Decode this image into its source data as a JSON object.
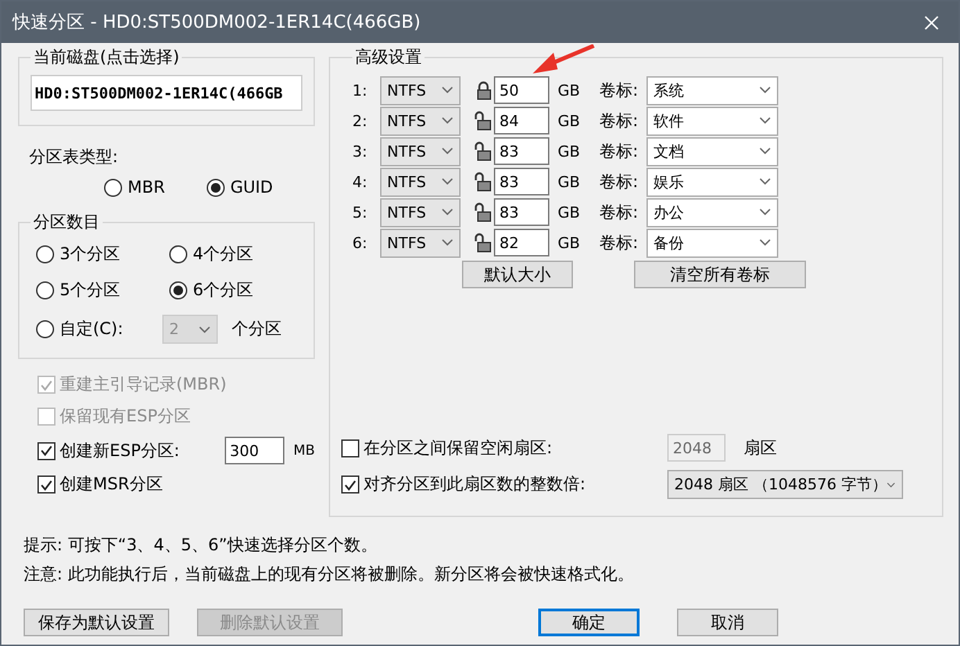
{
  "window": {
    "title": "快速分区 - HD0:ST500DM002-1ER14C(466GB)"
  },
  "disk": {
    "label": "当前磁盘(点击选择)",
    "value": "HD0:ST500DM002-1ER14C(466GB"
  },
  "table_type": {
    "label": "分区表类型:",
    "options": [
      {
        "label": "MBR",
        "selected": false
      },
      {
        "label": "GUID",
        "selected": true
      }
    ]
  },
  "count": {
    "label": "分区数目",
    "options": [
      {
        "kind": "preset",
        "label": "3个分区",
        "selected": false
      },
      {
        "kind": "preset",
        "label": "4个分区",
        "selected": false
      },
      {
        "kind": "preset",
        "label": "5个分区",
        "selected": false
      },
      {
        "kind": "preset",
        "label": "6个分区",
        "selected": true
      },
      {
        "kind": "custom",
        "label": "自定(C):",
        "selected": false,
        "value": "2",
        "suffix": "个分区",
        "disabled": true
      }
    ]
  },
  "checks": [
    {
      "label": "重建主引导记录(MBR)",
      "checked": true,
      "disabled": true
    },
    {
      "label": "保留现有ESP分区",
      "checked": false,
      "disabled": true
    },
    {
      "label": "创建新ESP分区:",
      "checked": true,
      "disabled": false,
      "value": "300",
      "unit": "MB"
    },
    {
      "label": "创建MSR分区",
      "checked": true,
      "disabled": false
    }
  ],
  "advanced": {
    "title": "高级设置",
    "partitions": [
      {
        "index": "1:",
        "fs": "NTFS",
        "locked": true,
        "size": "50",
        "unit": "GB",
        "caption": "卷标:",
        "volume": "系统"
      },
      {
        "index": "2:",
        "fs": "NTFS",
        "locked": false,
        "size": "84",
        "unit": "GB",
        "caption": "卷标:",
        "volume": "软件"
      },
      {
        "index": "3:",
        "fs": "NTFS",
        "locked": false,
        "size": "83",
        "unit": "GB",
        "caption": "卷标:",
        "volume": "文档"
      },
      {
        "index": "4:",
        "fs": "NTFS",
        "locked": false,
        "size": "83",
        "unit": "GB",
        "caption": "卷标:",
        "volume": "娱乐"
      },
      {
        "index": "5:",
        "fs": "NTFS",
        "locked": false,
        "size": "83",
        "unit": "GB",
        "caption": "卷标:",
        "volume": "办公"
      },
      {
        "index": "6:",
        "fs": "NTFS",
        "locked": false,
        "size": "82",
        "unit": "GB",
        "caption": "卷标:",
        "volume": "备份"
      }
    ],
    "default_size_button": "默认大小",
    "clear_labels_button": "清空所有卷标",
    "reserve": {
      "label": "在分区之间保留空闲扇区:",
      "checked": false,
      "disabled": true,
      "value": "2048",
      "unit": "扇区"
    },
    "align": {
      "label": "对齐分区到此扇区数的整数倍:",
      "checked": true,
      "value": "2048 扇区 （1048576 字节）"
    }
  },
  "notes": [
    "提示: 可按下“3、4、5、6”快速选择分区个数。",
    "注意: 此功能执行后，当前磁盘上的现有分区将被删除。新分区将会被快速格式化。"
  ],
  "left_buttons": [
    {
      "label": "保存为默认设置",
      "disabled": false,
      "default": false
    },
    {
      "label": "删除默认设置",
      "disabled": true,
      "default": false
    }
  ],
  "right_buttons": [
    {
      "label": "确定",
      "disabled": false,
      "default": true
    },
    {
      "label": "取消",
      "disabled": false,
      "default": false
    }
  ]
}
